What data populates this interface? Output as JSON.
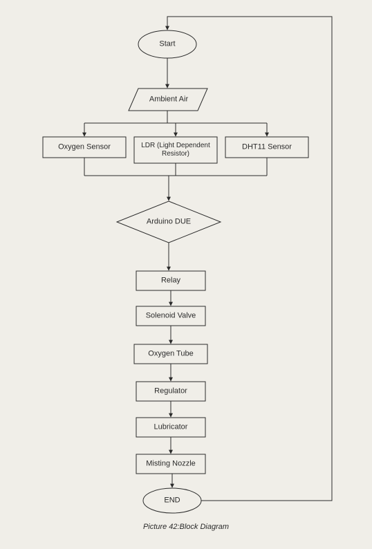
{
  "nodes": {
    "start": "Start",
    "ambient_air": "Ambient Air",
    "oxygen_sensor": "Oxygen Sensor",
    "ldr": "LDR (Light Dependent\nResistor)",
    "dht11": "DHT11 Sensor",
    "arduino": "Arduino DUE",
    "relay": "Relay",
    "solenoid": "Solenoid Valve",
    "oxygen_tube": "Oxygen Tube",
    "regulator": "Regulator",
    "lubricator": "Lubricator",
    "misting": "Misting Nozzle",
    "end": "END"
  },
  "caption": "Picture 42:Block Diagram"
}
